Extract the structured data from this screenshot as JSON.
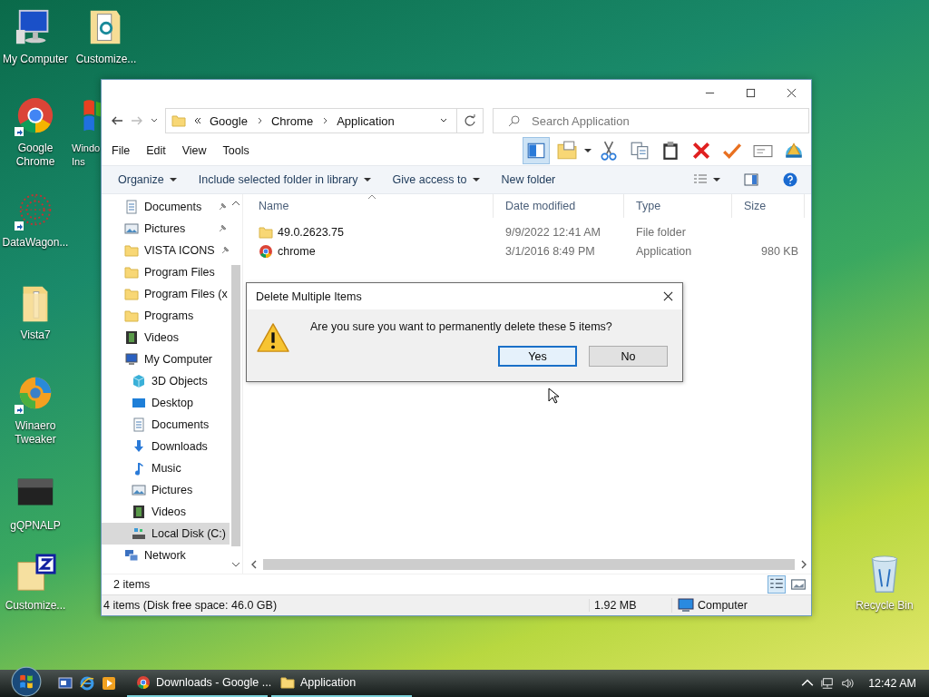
{
  "desktop_icons": [
    {
      "label": "My Computer",
      "kind": "computer",
      "shortcut": false
    },
    {
      "label": "Customize...",
      "kind": "doc-folder",
      "shortcut": false
    },
    {
      "label": "Google Chrome",
      "kind": "chrome",
      "shortcut": true
    },
    {
      "label": "Windo Ins",
      "kind": "windows",
      "shortcut": false
    },
    {
      "label": "DataWagon...",
      "kind": "dots",
      "shortcut": true
    },
    {
      "label": "Vista7",
      "kind": "folder",
      "shortcut": false
    },
    {
      "label": "Winaero Tweaker",
      "kind": "swirl",
      "shortcut": true
    },
    {
      "label": "gQPNALP",
      "kind": "black",
      "shortcut": false
    },
    {
      "label": "Customize...",
      "kind": "zip",
      "shortcut": false
    },
    {
      "label": "Recycle Bin",
      "kind": "bin",
      "shortcut": false
    }
  ],
  "window": {
    "address": {
      "crumbs": [
        "Google",
        "Chrome",
        "Application"
      ]
    },
    "search": {
      "placeholder": "Search Application"
    },
    "menu": [
      "File",
      "Edit",
      "View",
      "Tools"
    ],
    "toolbar": [
      {
        "kind": "pane",
        "selected": true
      },
      {
        "kind": "folder",
        "selected": false
      },
      {
        "kind": "cut",
        "selected": false
      },
      {
        "kind": "copy",
        "selected": false
      },
      {
        "kind": "paste",
        "selected": false
      },
      {
        "kind": "delete",
        "selected": false
      },
      {
        "kind": "check",
        "selected": false
      },
      {
        "kind": "mail",
        "selected": false
      },
      {
        "kind": "shell",
        "selected": false
      }
    ],
    "commands": [
      {
        "label": "Organize",
        "dropdown": true
      },
      {
        "label": "Include selected folder in library",
        "dropdown": true
      },
      {
        "label": "Give access to",
        "dropdown": true
      },
      {
        "label": "New folder",
        "dropdown": false
      }
    ],
    "nav": [
      {
        "label": "Documents",
        "kind": "documents",
        "pinned": true,
        "selected": false
      },
      {
        "label": "Pictures",
        "kind": "pictures",
        "pinned": true,
        "selected": false
      },
      {
        "label": "VISTA ICONS",
        "kind": "folder",
        "pinned": true,
        "selected": false
      },
      {
        "label": "Program Files",
        "kind": "folder",
        "pinned": false,
        "selected": false
      },
      {
        "label": "Program Files (x",
        "kind": "folder",
        "pinned": false,
        "selected": false
      },
      {
        "label": "Programs",
        "kind": "folder",
        "pinned": false,
        "selected": false
      },
      {
        "label": "Videos",
        "kind": "videos",
        "pinned": false,
        "selected": false
      },
      {
        "label": "My Computer",
        "kind": "computer",
        "pinned": false,
        "selected": false,
        "children": [
          {
            "label": "3D Objects",
            "kind": "cube",
            "pinned": false,
            "selected": false
          },
          {
            "label": "Desktop",
            "kind": "desktop",
            "pinned": false,
            "selected": false
          },
          {
            "label": "Documents",
            "kind": "documents",
            "pinned": false,
            "selected": false
          },
          {
            "label": "Downloads",
            "kind": "downloads",
            "pinned": false,
            "selected": false
          },
          {
            "label": "Music",
            "kind": "music",
            "pinned": false,
            "selected": false
          },
          {
            "label": "Pictures",
            "kind": "pictures",
            "pinned": false,
            "selected": false
          },
          {
            "label": "Videos",
            "kind": "videos",
            "pinned": false,
            "selected": false
          },
          {
            "label": "Local Disk (C:)",
            "kind": "disk",
            "pinned": false,
            "selected": true
          }
        ]
      },
      {
        "label": "Network",
        "kind": "network",
        "pinned": false,
        "selected": false
      }
    ],
    "columns": [
      "Name",
      "Date modified",
      "Type",
      "Size"
    ],
    "rows": [
      {
        "name": "49.0.2623.75",
        "kind": "folder",
        "date": "9/9/2022 12:41 AM",
        "type": "File folder"
      },
      {
        "name": "chrome",
        "kind": "chrome",
        "date": "3/1/2016 8:49 PM",
        "type": "Application",
        "size": "980 KB"
      }
    ],
    "details": "2 items",
    "status_bar": {
      "summary": "4 items (Disk free space: 46.0 GB)",
      "size": "1.92 MB",
      "location": "Computer"
    }
  },
  "dialog": {
    "title": "Delete Multiple Items",
    "message": "Are you sure you want to permanently delete these 5 items?",
    "buttons": [
      {
        "label": "Yes",
        "selected": true
      },
      {
        "label": "No",
        "selected": false
      }
    ]
  },
  "taskbar": {
    "tasks": [
      {
        "label": "Downloads - Google ...",
        "kind": "chrome"
      },
      {
        "label": "Application",
        "kind": "folder"
      }
    ],
    "clock": "12:42 AM"
  }
}
